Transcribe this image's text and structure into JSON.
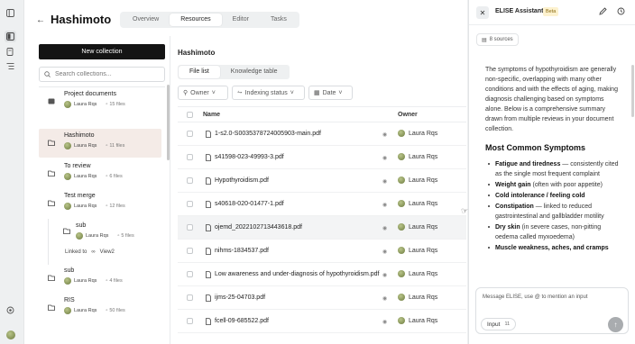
{
  "project": {
    "title": "Hashimoto",
    "tabs": [
      "Overview",
      "Resources",
      "Editor",
      "Tasks"
    ]
  },
  "collections": {
    "new_button": "New collection",
    "search_placeholder": "Search collections...",
    "items": [
      {
        "name": "Project documents",
        "owner": "Laura Rqs",
        "files": "15 files"
      },
      {
        "name": "Hashimoto",
        "owner": "Laura Rqs",
        "files": "11 files"
      },
      {
        "name": "To review",
        "owner": "Laura Rqs",
        "files": "6 files"
      },
      {
        "name": "Test merge",
        "owner": "Laura Rqs",
        "files": "12 files"
      },
      {
        "name": "sub",
        "owner": "Laura Rqs",
        "files": "4 files"
      },
      {
        "name": "RIS",
        "owner": "Laura Rqs",
        "files": "50 files"
      }
    ],
    "nested": {
      "name": "sub",
      "owner": "Laura Rqs",
      "files": "5 files",
      "linked_label": "Linked to",
      "linked_view": "View2"
    }
  },
  "files": {
    "title": "Hashimoto",
    "tabs": [
      "File list",
      "Knowledge table"
    ],
    "filters": [
      "Owner",
      "Indexing status",
      "Date"
    ],
    "columns": {
      "name": "Name",
      "owner": "Owner"
    },
    "rows": [
      {
        "name": "1-s2.0-S0035378724005903-main.pdf",
        "owner": "Laura Rqs"
      },
      {
        "name": "s41598-023-49993-3.pdf",
        "owner": "Laura Rqs"
      },
      {
        "name": "Hypothyroidism.pdf",
        "owner": "Laura Rqs"
      },
      {
        "name": "s40618-020-01477-1.pdf",
        "owner": "Laura Rqs"
      },
      {
        "name": "ojemd_2022102713443618.pdf",
        "owner": "Laura Rqs"
      },
      {
        "name": "nihms-1834537.pdf",
        "owner": "Laura Rqs"
      },
      {
        "name": "Low awareness and under-diagnosis of hypothyroidism.pdf",
        "owner": "Laura Rqs"
      },
      {
        "name": "ijms-25-04703.pdf",
        "owner": "Laura Rqs"
      },
      {
        "name": "fcell-09-685522.pdf",
        "owner": "Laura Rqs"
      }
    ]
  },
  "assistant": {
    "title": "ELISE Assistant",
    "badge": "Beta",
    "sources": "8 sources",
    "intro": "The symptoms of hypothyroidism are generally non-specific, overlapping with many other conditions and with the effects of aging, making diagnosis challenging based on symptoms alone. Below is a comprehensive summary drawn from multiple reviews in your document collection.",
    "heading": "Most Common Symptoms",
    "symptoms": [
      {
        "term": "Fatigue and tiredness",
        "desc": " — consistently cited as the single most frequent complaint"
      },
      {
        "term": "Weight gain",
        "desc": " (often with poor appetite)"
      },
      {
        "term": "Cold intolerance / feeling cold",
        "desc": ""
      },
      {
        "term": "Constipation",
        "desc": " — linked to reduced gastrointestinal and gallbladder motility"
      },
      {
        "term": "Dry skin",
        "desc": " (in severe cases, non-pitting oedema called myxoedema)"
      },
      {
        "term": "Muscle weakness, aches, and cramps",
        "desc": ""
      }
    ],
    "composer_placeholder": "Message ELISE, use @ to mention an input",
    "input_label": "Input",
    "input_count": "11"
  },
  "colors": {
    "primary_button": "#141414",
    "active_collection": "#f4ebe7",
    "beta_badge": "#fdf2cf"
  },
  "icons": [
    "collapse-icon",
    "resources-icon",
    "library-icon",
    "tasks-icon",
    "settings-icon",
    "back-arrow-icon",
    "search-icon",
    "folder-icon",
    "user-icon",
    "file-icon",
    "link-icon",
    "chevron-down-icon",
    "calendar-icon",
    "globe-icon",
    "close-icon",
    "edit-icon",
    "history-icon",
    "sources-icon",
    "send-icon"
  ]
}
